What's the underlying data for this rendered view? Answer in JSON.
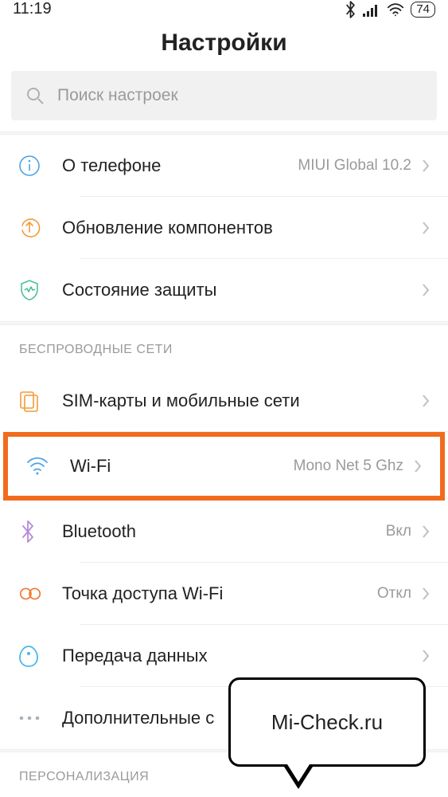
{
  "status": {
    "time": "11:19",
    "battery": "74"
  },
  "title": "Настройки",
  "search": {
    "placeholder": "Поиск настроек"
  },
  "top_items": [
    {
      "key": "about",
      "label": "О телефоне",
      "value": "MIUI Global 10.2"
    },
    {
      "key": "update",
      "label": "Обновление компонентов",
      "value": ""
    },
    {
      "key": "security",
      "label": "Состояние защиты",
      "value": ""
    }
  ],
  "sections": {
    "wireless": {
      "header": "БЕСПРОВОДНЫЕ СЕТИ",
      "items": [
        {
          "key": "sim",
          "label": "SIM-карты и мобильные сети",
          "value": ""
        },
        {
          "key": "wifi",
          "label": "Wi-Fi",
          "value": "Mono Net 5 Ghz",
          "highlight": true
        },
        {
          "key": "bt",
          "label": "Bluetooth",
          "value": "Вкл"
        },
        {
          "key": "hotspot",
          "label": "Точка доступа Wi-Fi",
          "value": "Откл"
        },
        {
          "key": "data",
          "label": "Передача данных",
          "value": ""
        },
        {
          "key": "more",
          "label": "Дополнительные с",
          "value": ""
        }
      ]
    },
    "personalization": {
      "header": "ПЕРСОНАЛИЗАЦИЯ"
    }
  },
  "callout": {
    "text": "Mi-Check.ru"
  }
}
